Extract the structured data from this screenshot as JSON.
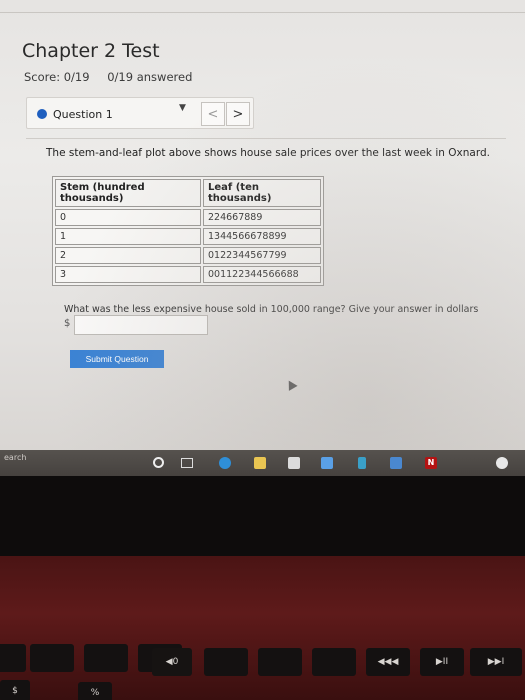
{
  "header": {
    "title": "Chapter 2 Test",
    "score": "Score: 0/19",
    "answered": "0/19 answered"
  },
  "question_nav": {
    "label": "Question 1",
    "caret": "▼",
    "prev": "<",
    "next": ">"
  },
  "question": {
    "prompt": "The stem-and-leaf plot above shows house sale prices over the last week in Oxnard.",
    "table": {
      "headers": [
        "Stem (hundred thousands)",
        "Leaf (ten thousands)"
      ],
      "rows": [
        [
          "0",
          "224667889"
        ],
        [
          "1",
          "1344566678899"
        ],
        [
          "2",
          "0122344567799"
        ],
        [
          "3",
          "001122344566688"
        ]
      ]
    },
    "answer_prompt": "What was the less expensive house sold in 100,000 range? Give your answer in dollars",
    "currency": "$",
    "answer_value": "",
    "submit_label": "Submit Question"
  },
  "taskbar": {
    "search_label": "earch",
    "icons": [
      "task-view-icon",
      "edge-icon",
      "file-explorer-icon",
      "store-icon",
      "dropbox-icon",
      "arrow-icon",
      "mail-icon",
      "netflix-icon",
      "chrome-icon"
    ],
    "netflix_letter": "N"
  },
  "keyboard": {
    "fn_keys": [
      "",
      "",
      "",
      "",
      "◀0",
      "",
      "",
      "",
      "◀◀◀",
      "▶II",
      "▶▶I"
    ],
    "number_keys": [
      "$",
      "%"
    ]
  },
  "colors": {
    "accent": "#3a82d4",
    "question_dot": "#1f5fbf",
    "laptop_red": "#5e1a1a"
  }
}
